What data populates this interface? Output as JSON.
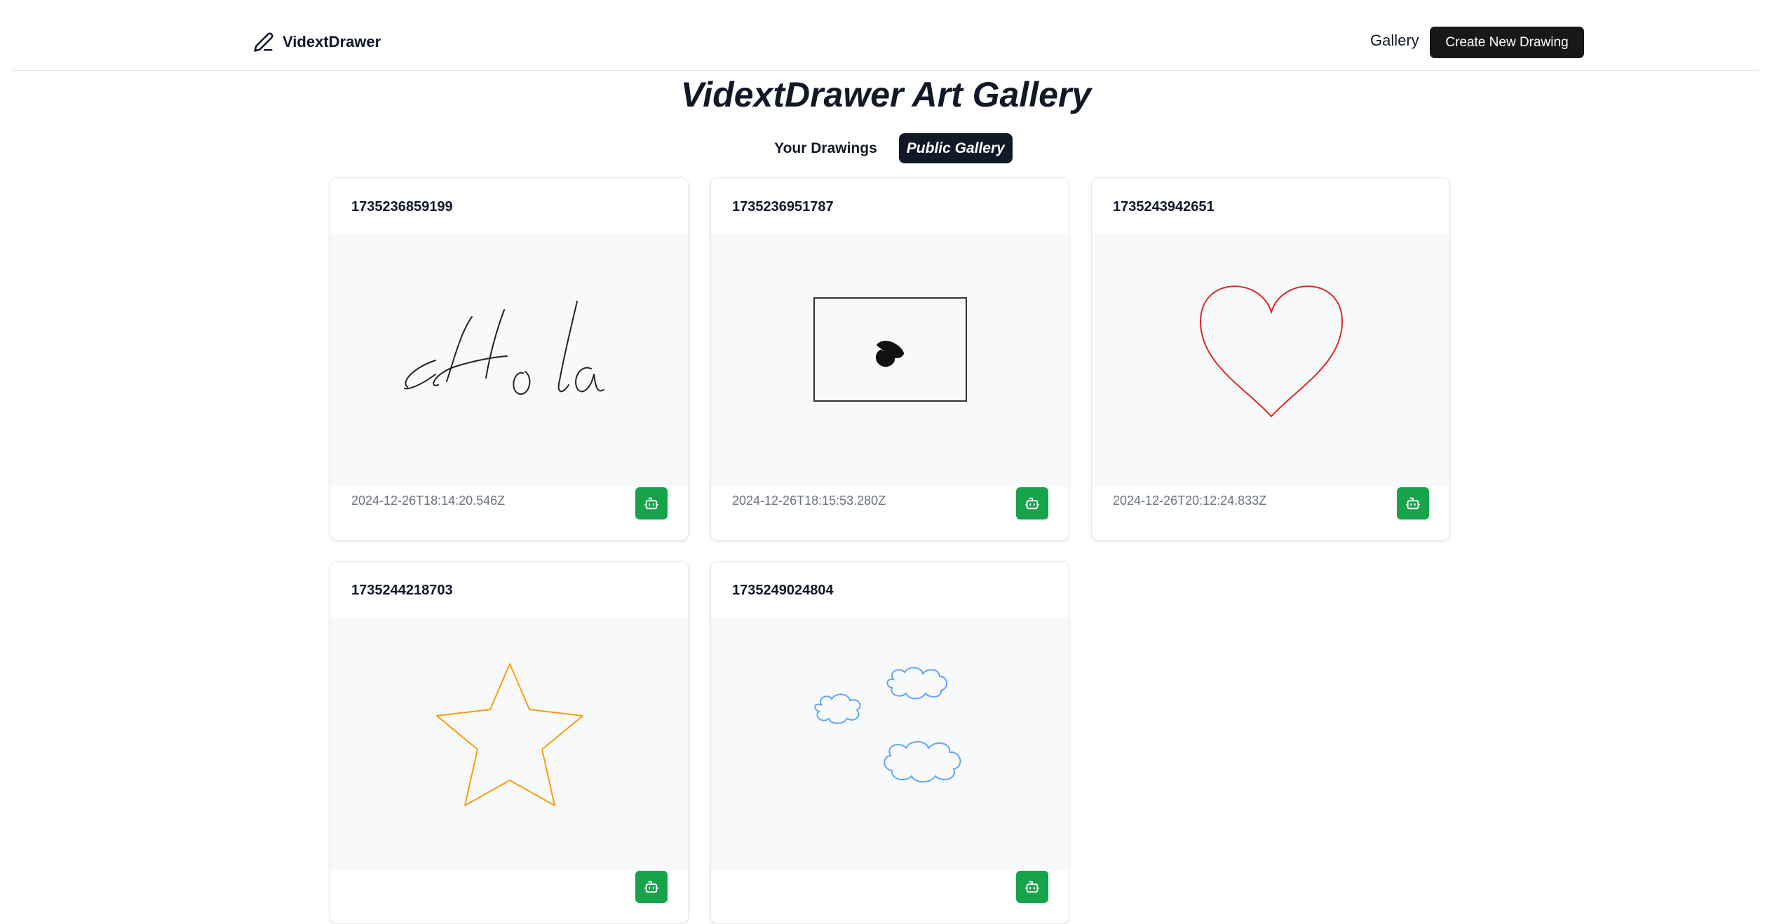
{
  "header": {
    "brand": "VidextDrawer",
    "nav_gallery": "Gallery",
    "create_button": "Create New Drawing"
  },
  "page": {
    "title": "VidextDrawer Art Gallery"
  },
  "tabs": [
    {
      "label": "Your Drawings",
      "active": false
    },
    {
      "label": "Public Gallery",
      "active": true
    }
  ],
  "drawings": [
    {
      "id": "1735236859199",
      "date": "2024-12-26T18:14:20.546Z",
      "content": "Hola handwriting",
      "stroke": "#222222"
    },
    {
      "id": "1735236951787",
      "date": "2024-12-26T18:15:53.280Z",
      "content": "rectangle with scribble",
      "stroke": "#333333"
    },
    {
      "id": "1735243942651",
      "date": "2024-12-26T20:12:24.833Z",
      "content": "heart outline",
      "stroke": "#dc2626"
    },
    {
      "id": "1735244218703",
      "date": "",
      "content": "star outline",
      "stroke": "#f59e0b"
    },
    {
      "id": "1735249024804",
      "date": "",
      "content": "three clouds",
      "stroke": "#60a5fa"
    }
  ],
  "colors": {
    "primary": "#18181b",
    "ai_button": "#16a34a",
    "canvas_bg": "#f8f9fb"
  },
  "icons": {
    "brand": "pencil-icon",
    "ai_button": "bot-icon"
  }
}
